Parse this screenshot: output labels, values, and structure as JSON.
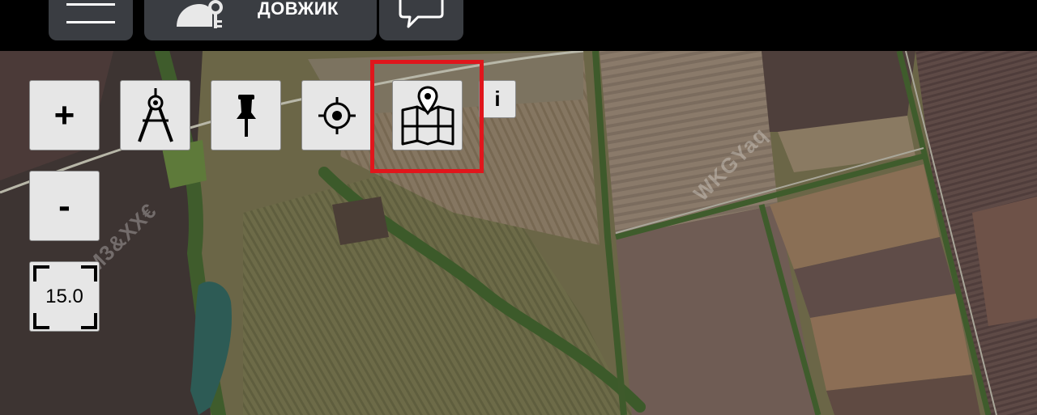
{
  "topbar": {
    "menu_icon": "hamburger-menu-icon",
    "tool_icon": "helmet-key-icon",
    "tool_label": "ДОВЖИК",
    "chat_icon": "speech-bubble-icon"
  },
  "map": {
    "type": "satellite",
    "watermarks": [
      "M3&XX€",
      "WKGYaq"
    ]
  },
  "controls": {
    "zoom_in_label": "+",
    "zoom_out_label": "-",
    "zoom_level": "15.0",
    "info_label": "i",
    "icons": [
      "compass-divider-icon",
      "pushpin-icon",
      "locate-target-icon",
      "map-marker-icon"
    ]
  },
  "colors": {
    "highlight": "#e0161c",
    "control_bg": "#e6e6e6",
    "topbar_button_bg": "#3a3d42"
  }
}
